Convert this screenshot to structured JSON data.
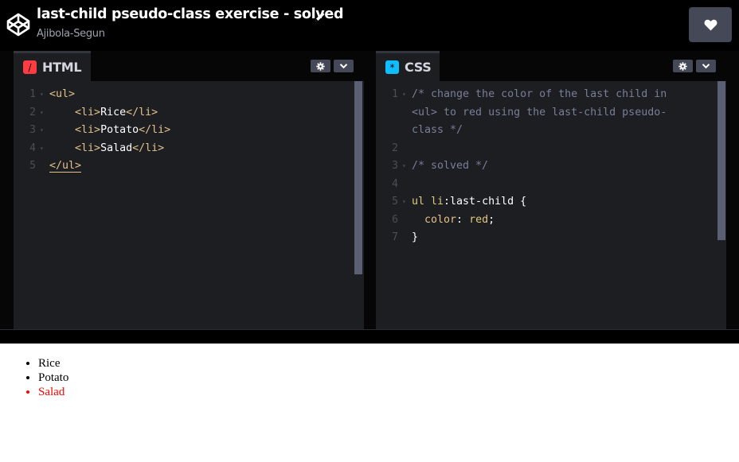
{
  "header": {
    "title": "last-child pseudo-class exercise - solved",
    "author": "Ajibola-Segun",
    "logo_icon": "codepen-logo-icon",
    "edit_icon": "pencil-icon",
    "love_icon": "heart-icon"
  },
  "editors": {
    "html": {
      "tab_label": "HTML",
      "icon_glyph": "/",
      "icon_color": "#ff3c41",
      "lines": [
        {
          "n": "1",
          "fold": "▾",
          "parts": [
            {
              "t": "<ul>",
              "c": "tag"
            }
          ]
        },
        {
          "n": "2",
          "fold": "▾",
          "parts": [
            {
              "t": "    ",
              "c": "plain"
            },
            {
              "t": "<li>",
              "c": "tag"
            },
            {
              "t": "Rice",
              "c": "plain"
            },
            {
              "t": "</li>",
              "c": "tag"
            }
          ]
        },
        {
          "n": "3",
          "fold": "▾",
          "parts": [
            {
              "t": "    ",
              "c": "plain"
            },
            {
              "t": "<li>",
              "c": "tag"
            },
            {
              "t": "Potato",
              "c": "plain"
            },
            {
              "t": "</li>",
              "c": "tag"
            }
          ]
        },
        {
          "n": "4",
          "fold": "▾",
          "parts": [
            {
              "t": "    ",
              "c": "plain"
            },
            {
              "t": "<li>",
              "c": "tag"
            },
            {
              "t": "Salad",
              "c": "plain"
            },
            {
              "t": "</li>",
              "c": "tag"
            }
          ]
        },
        {
          "n": "5",
          "fold": "",
          "parts": [
            {
              "t": "</ul>",
              "c": "tag"
            }
          ]
        }
      ]
    },
    "css": {
      "tab_label": "CSS",
      "icon_glyph": "*",
      "icon_color": "#0ebeff",
      "lines": [
        {
          "n": "1",
          "fold": "▾",
          "parts": [
            {
              "t": "/* change the color of the last child in",
              "c": "comment"
            }
          ]
        },
        {
          "n": "",
          "fold": "",
          "parts": [
            {
              "t": "<ul> to red using the last-child pseudo-",
              "c": "comment"
            }
          ]
        },
        {
          "n": "",
          "fold": "",
          "parts": [
            {
              "t": "class */",
              "c": "comment"
            }
          ]
        },
        {
          "n": "2",
          "fold": "",
          "parts": []
        },
        {
          "n": "3",
          "fold": "▾",
          "parts": [
            {
              "t": "/* solved */",
              "c": "comment"
            }
          ]
        },
        {
          "n": "4",
          "fold": "",
          "parts": []
        },
        {
          "n": "5",
          "fold": "▾",
          "parts": [
            {
              "t": "ul li",
              "c": "selkw"
            },
            {
              "t": ":last-child {",
              "c": "sel"
            }
          ]
        },
        {
          "n": "6",
          "fold": "",
          "parts": [
            {
              "t": "  ",
              "c": "plain"
            },
            {
              "t": "color",
              "c": "prop"
            },
            {
              "t": ": ",
              "c": "plain"
            },
            {
              "t": "red",
              "c": "val"
            },
            {
              "t": ";",
              "c": "plain"
            }
          ]
        },
        {
          "n": "7",
          "fold": "",
          "parts": [
            {
              "t": "}",
              "c": "plain"
            }
          ]
        }
      ]
    }
  },
  "preview": {
    "items": [
      "Rice",
      "Potato",
      "Salad"
    ],
    "last_item_color": "#ff0000"
  },
  "colors": {
    "background": "#000000",
    "panel": "#1d1e22",
    "button": "#444857"
  }
}
